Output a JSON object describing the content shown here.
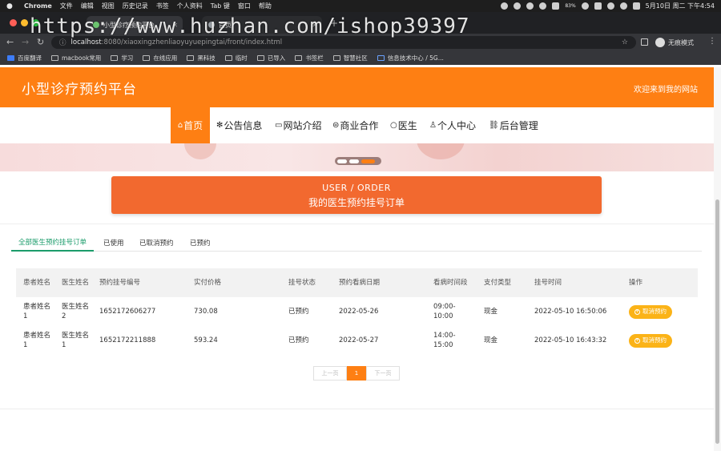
{
  "macbar": {
    "app": "Chrome",
    "menus": [
      "文件",
      "编辑",
      "视图",
      "历史记录",
      "书签",
      "个人资料",
      "Tab 键",
      "窗口",
      "帮助"
    ],
    "clock": "5月10日 周二 下午4:54",
    "mem": "83%"
  },
  "browser": {
    "active_tab": "小型诊疗预约平台",
    "other_tab": "首页",
    "url_host": "localhost",
    "url_path": ":8080/xiaoxingzhenliaoyuyuepingtai/front/index.html",
    "incognito": "无痕模式"
  },
  "bookmarks": [
    "百度翻译",
    "macbook常用",
    "学习",
    "在线应用",
    "黑科技",
    "临时",
    "已导入",
    "书签栏",
    "智慧社区",
    "信息技术中心 / 5G..."
  ],
  "header": {
    "title": "小型诊疗预约平台",
    "welcome": "欢迎来到我的网站"
  },
  "nav": {
    "items": [
      "首页",
      "公告信息",
      "网站介绍",
      "商业合作",
      "医生",
      "个人中心",
      "后台管理"
    ],
    "active_index": 0
  },
  "order_button": {
    "line1": "USER / ORDER",
    "line2": "我的医生预约挂号订单"
  },
  "tabs": [
    "全部医生预约挂号订单",
    "已使用",
    "已取消预约",
    "已预约"
  ],
  "table": {
    "headers": [
      "患者姓名",
      "医生姓名",
      "预约挂号编号",
      "实付价格",
      "挂号状态",
      "预约看病日期",
      "看病时间段",
      "支付类型",
      "挂号时间",
      "操作"
    ],
    "rows": [
      [
        "患者姓名1",
        "医生姓名2",
        "1652172606277",
        "730.08",
        "已预约",
        "2022-05-26",
        "09:00-10:00",
        "现金",
        "2022-05-10 16:50:06",
        "取消预约"
      ],
      [
        "患者姓名1",
        "医生姓名1",
        "1652172211888",
        "593.24",
        "已预约",
        "2022-05-27",
        "14:00-15:00",
        "现金",
        "2022-05-10 16:43:32",
        "取消预约"
      ]
    ]
  },
  "pager": {
    "prev": "上一页",
    "current": "1",
    "next": "下一页"
  },
  "watermark": "https://www.huzhan.com/ishop39397",
  "colors": {
    "brand": "#fe7f13",
    "order_button": "#f2692f",
    "tab_active": "#1b9c6b",
    "cancel_button": "#fbb317"
  }
}
